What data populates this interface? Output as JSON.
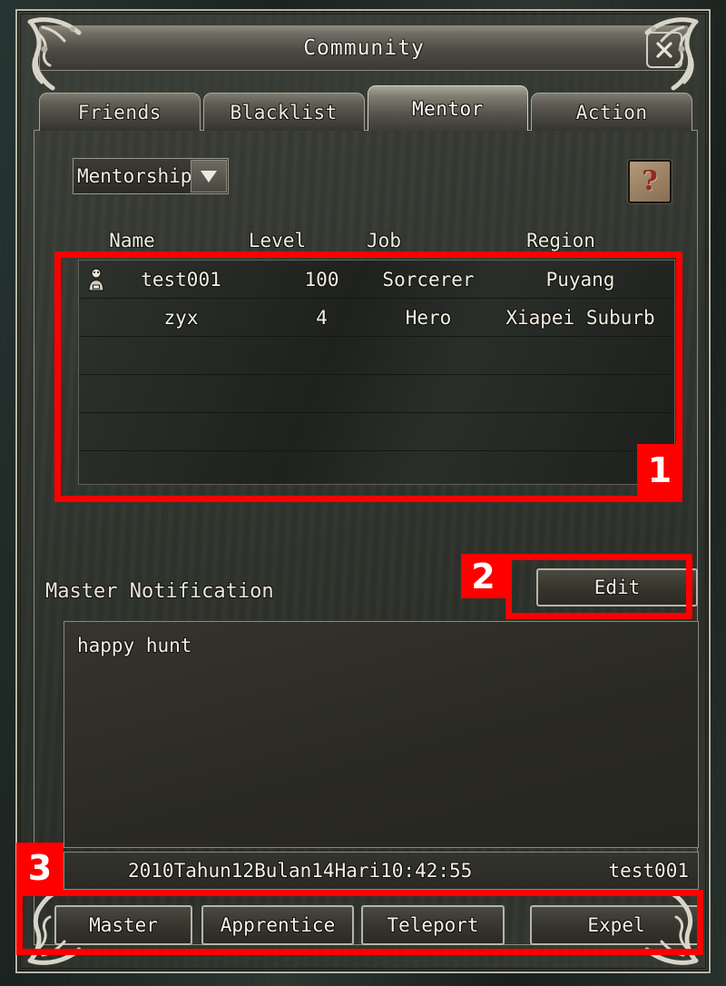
{
  "window": {
    "title": "Community",
    "close_icon": "close-x-icon"
  },
  "tabs": [
    {
      "label": "Friends",
      "active": false
    },
    {
      "label": "Blacklist",
      "active": false
    },
    {
      "label": "Mentor",
      "active": true
    },
    {
      "label": "Action",
      "active": false
    }
  ],
  "toolbar": {
    "dropdown_value": "Mentorship",
    "dropdown_arrow_icon": "chevron-down-icon",
    "help_icon": "question-mark-icon",
    "help_glyph": "?"
  },
  "table": {
    "columns": [
      "Name",
      "Level",
      "Job",
      "Region"
    ],
    "rows": [
      {
        "icon": "master-bust-icon",
        "name": "test001",
        "level": "100",
        "job": "Sorcerer",
        "region": "Puyang"
      },
      {
        "icon": "",
        "name": "zyx",
        "level": "4",
        "job": "Hero",
        "region": "Xiapei Suburb"
      }
    ],
    "empty_rows": 4
  },
  "notification": {
    "label": "Master Notification",
    "edit_label": "Edit",
    "body": "happy hunt",
    "timestamp": "2010Tahun12Bulan14Hari10:42:55",
    "author": "test001"
  },
  "bottom_buttons": [
    {
      "label": "Master"
    },
    {
      "label": "Apprentice"
    },
    {
      "label": "Teleport"
    },
    {
      "label": "Expel"
    }
  ],
  "annotations": [
    {
      "number": "1"
    },
    {
      "number": "2"
    },
    {
      "number": "3"
    }
  ],
  "colors": {
    "annotation": "#fe0000",
    "frame_border": "#b9b6a6",
    "text": "#f1efe5"
  }
}
